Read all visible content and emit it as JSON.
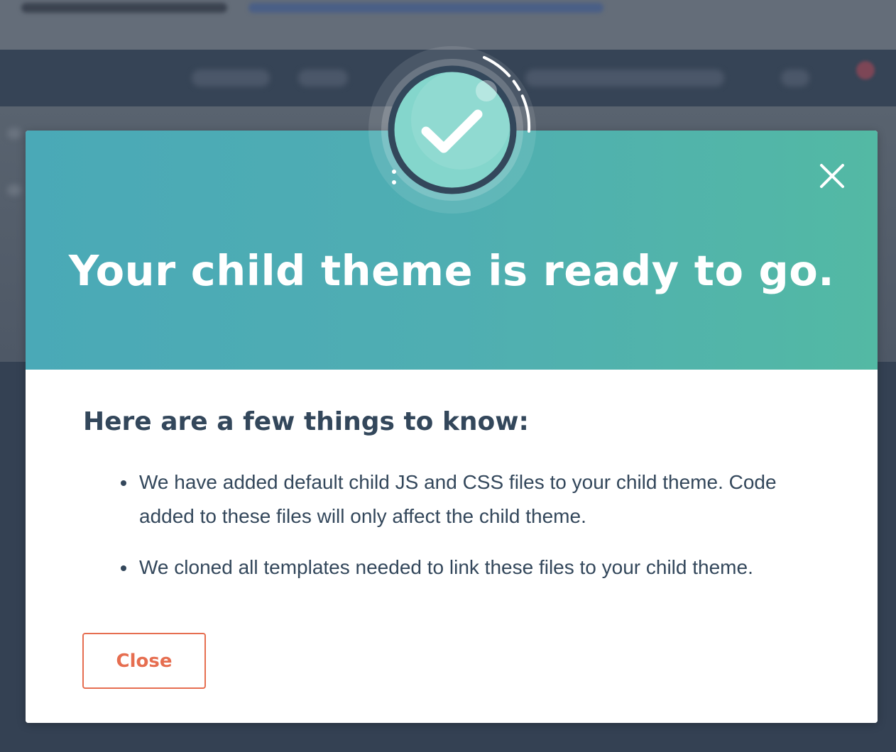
{
  "modal": {
    "title": "Your child theme is ready to go.",
    "close_icon": "close-icon",
    "badge_icon": "check-circle-icon",
    "heading": "Here are a few things to know:",
    "notes": [
      "We have added default child JS and CSS files to your child theme. Code added to these files will only affect the child theme.",
      "We cloned all templates needed to link these files to your child theme."
    ],
    "close_button_label": "Close"
  },
  "colors": {
    "header_gradient_start": "#4aa9b7",
    "header_gradient_end": "#53b9a4",
    "heading_text": "#33475b",
    "button_accent": "#e66e50",
    "badge_ring": "#33475b",
    "badge_fill": "#84d6cc"
  }
}
